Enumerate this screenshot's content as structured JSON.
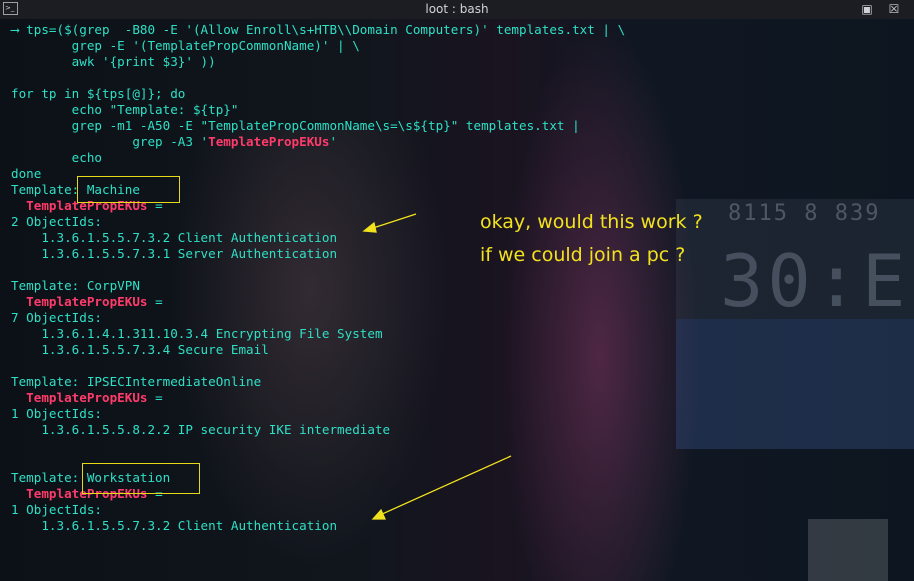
{
  "window": {
    "title": "loot : bash",
    "app_icon": ">_"
  },
  "terminal": {
    "lines": [
      "⟶ tps=($(grep  -B80 -E '(Allow Enroll\\s+HTB\\\\Domain Computers)' templates.txt | \\",
      "        grep -E '(TemplatePropCommonName)' | \\",
      "        awk '{print $3}' ))",
      "",
      "for tp in ${tps[@]}; do",
      "        echo \"Template: ${tp}\"",
      "        grep -m1 -A50 -E \"TemplatePropCommonName\\s=\\s${tp}\" templates.txt |",
      "                grep -A3 'TemplatePropEKUs'",
      "        echo",
      "done",
      "Template: Machine",
      "  TemplatePropEKUs =",
      "2 ObjectIds:",
      "    1.3.6.1.5.5.7.3.2 Client Authentication",
      "    1.3.6.1.5.5.7.3.1 Server Authentication",
      "",
      "Template: CorpVPN",
      "  TemplatePropEKUs =",
      "7 ObjectIds:",
      "    1.3.6.1.4.1.311.10.3.4 Encrypting File System",
      "    1.3.6.1.5.5.7.3.4 Secure Email",
      "",
      "Template: IPSECIntermediateOnline",
      "  TemplatePropEKUs =",
      "1 ObjectIds:",
      "    1.3.6.1.5.5.8.2.2 IP security IKE intermediate",
      "",
      "",
      "Template: Workstation",
      "  TemplatePropEKUs =",
      "1 ObjectIds:",
      "    1.3.6.1.5.5.7.3.2 Client Authentication"
    ],
    "ekus_label": "TemplatePropEKUs"
  },
  "annotation": {
    "line1": "okay, would this work ?",
    "line2": "if we could join a pc ?"
  },
  "background": {
    "clock_small": "8115  8 839",
    "clock_big": "30:E"
  },
  "colors": {
    "terminal_text": "#2ee0c6",
    "eku_text": "#ff3b6b",
    "annotation": "#f2e21d"
  }
}
